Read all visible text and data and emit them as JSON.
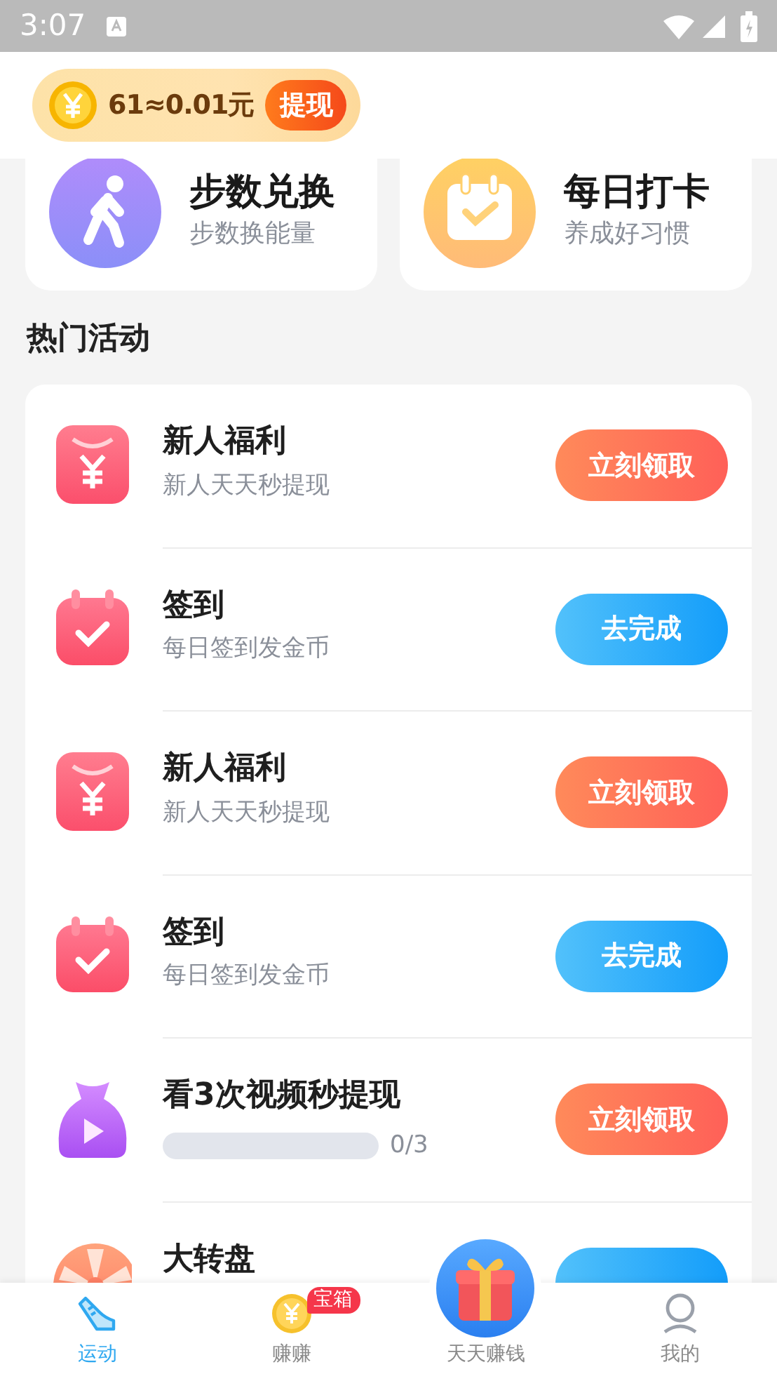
{
  "status_bar": {
    "time": "3:07"
  },
  "balance": {
    "text": "61≈0.01元",
    "withdraw_button": "提现"
  },
  "shortcuts": [
    {
      "kind": "steps",
      "title": "步数兑换",
      "subtitle": "步数换能量"
    },
    {
      "kind": "checkin",
      "title": "每日打卡",
      "subtitle": "养成好习惯"
    }
  ],
  "section_title": "热门活动",
  "activities": [
    {
      "kind": "welfare",
      "title": "新人福利",
      "subtitle": "新人天天秒提现",
      "button": {
        "kind": "claim",
        "label": "立刻领取"
      }
    },
    {
      "kind": "checkin",
      "title": "签到",
      "subtitle": "每日签到发金币",
      "button": {
        "kind": "do",
        "label": "去完成"
      }
    },
    {
      "kind": "welfare",
      "title": "新人福利",
      "subtitle": "新人天天秒提现",
      "button": {
        "kind": "claim",
        "label": "立刻领取"
      }
    },
    {
      "kind": "checkin",
      "title": "签到",
      "subtitle": "每日签到发金币",
      "button": {
        "kind": "do",
        "label": "去完成"
      }
    },
    {
      "kind": "video",
      "title": "看3次视频秒提现",
      "progress": {
        "level": 0,
        "reading": "0/3"
      },
      "button": {
        "kind": "claim",
        "label": "立刻领取"
      }
    },
    {
      "kind": "wheel",
      "title": "大转盘",
      "button": {
        "kind": "do"
      }
    }
  ],
  "bottom_nav": [
    {
      "kind": "shoe",
      "label": "运动",
      "selected": true
    },
    {
      "kind": "coin",
      "label": "赚赚",
      "selected": false,
      "badge": "宝箱"
    },
    {
      "kind": "gift",
      "label": "天天赚钱",
      "selected": false
    },
    {
      "kind": "person",
      "label": "我的",
      "selected": false
    }
  ]
}
